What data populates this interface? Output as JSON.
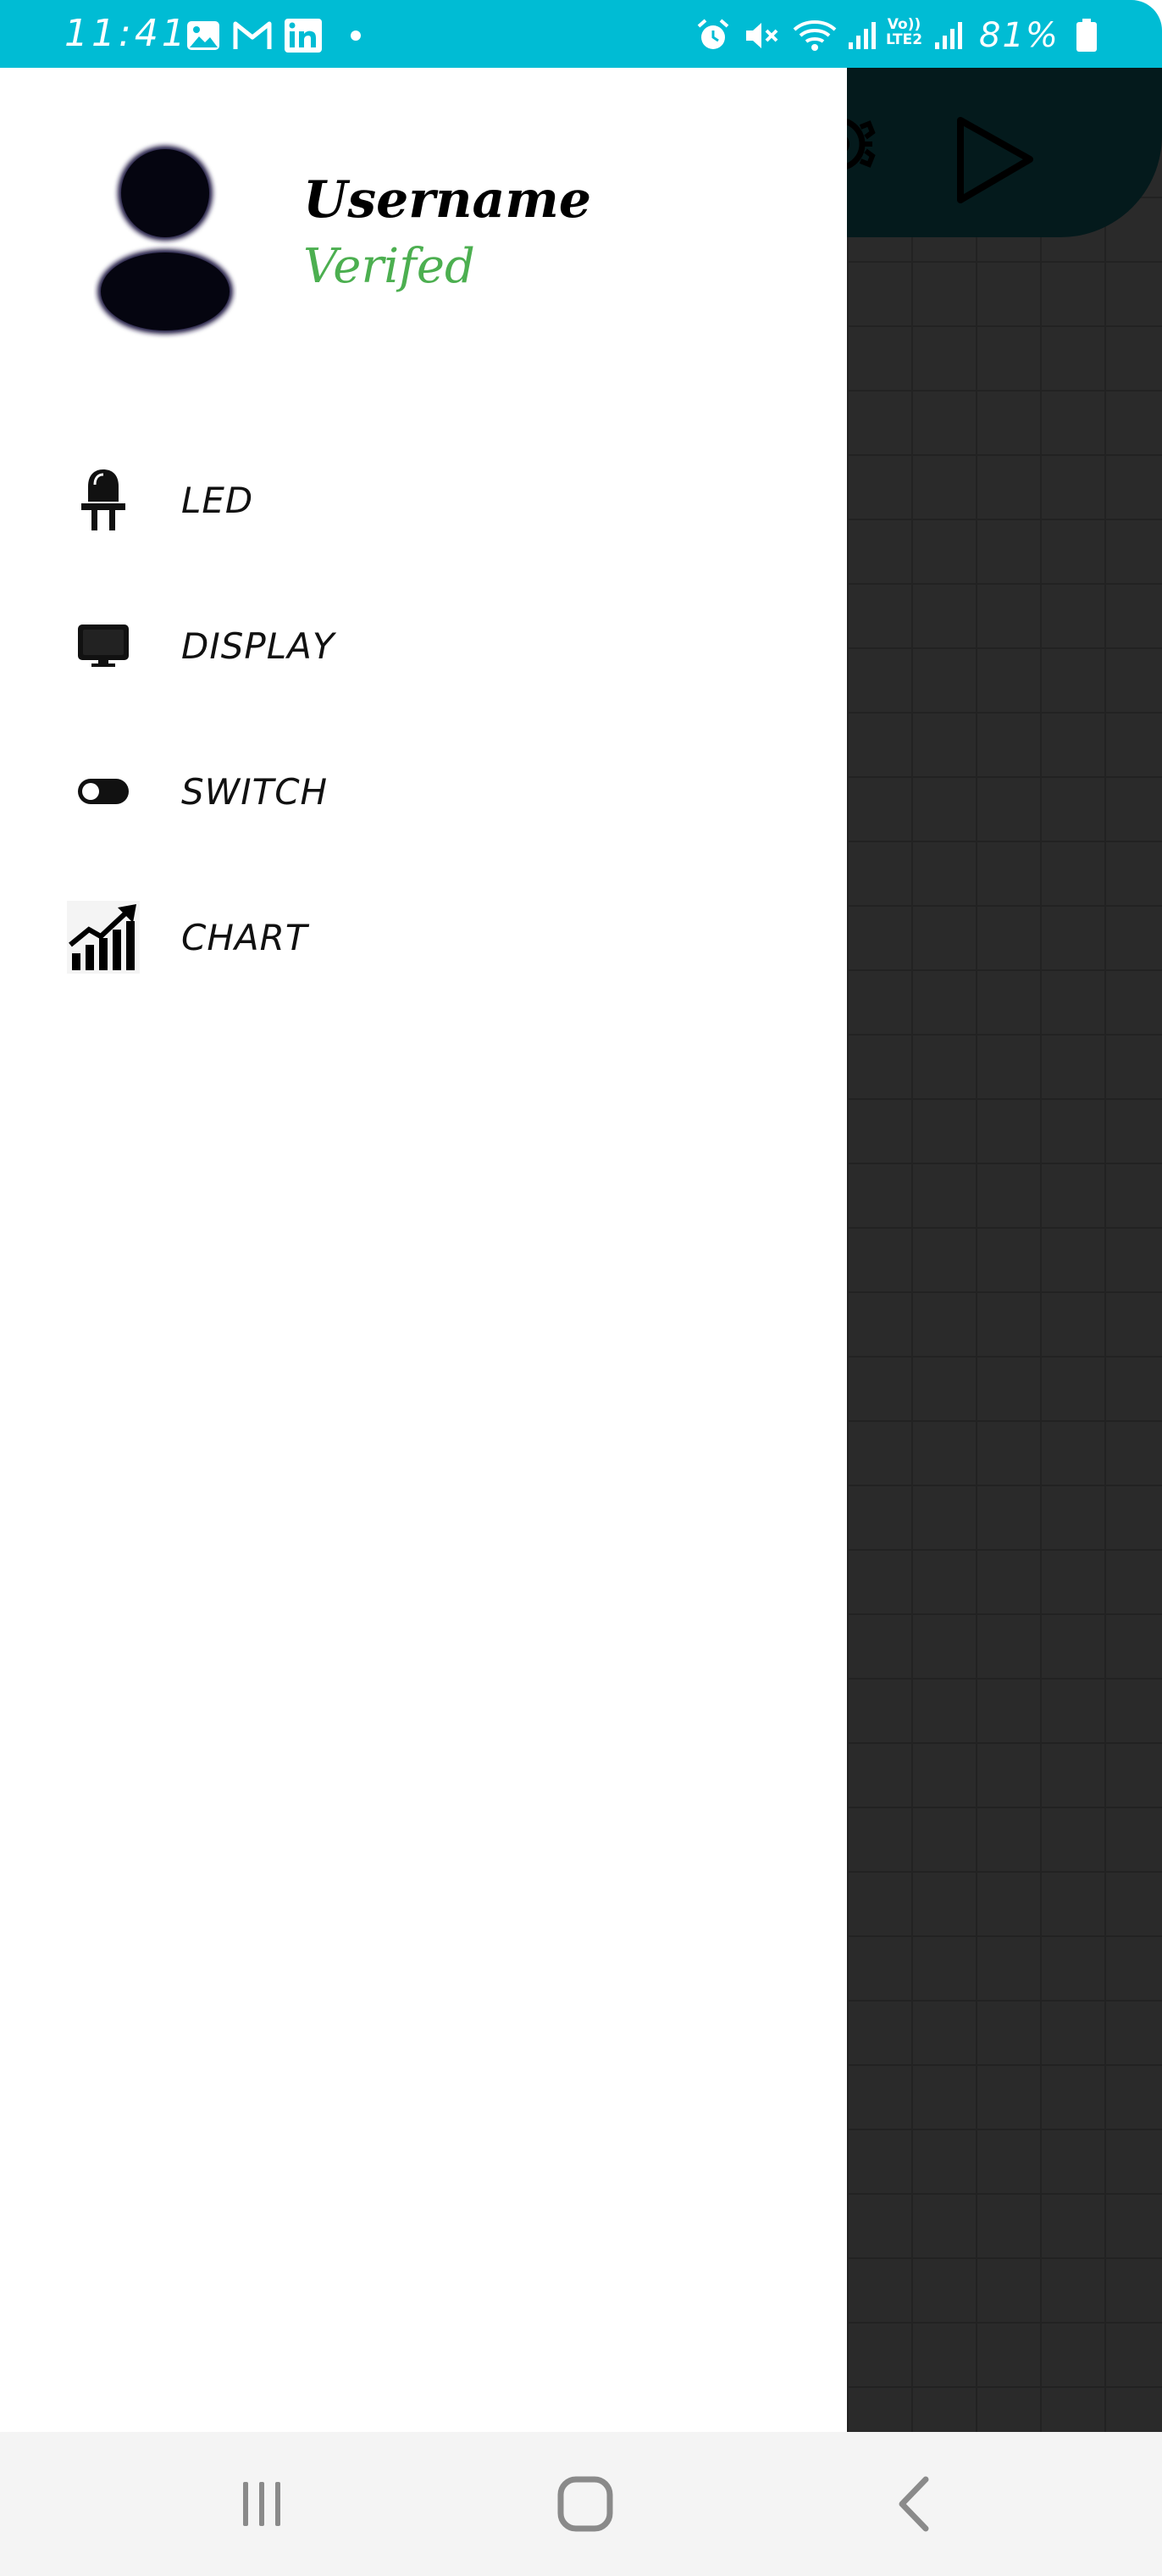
{
  "status_bar": {
    "time": "11:41",
    "battery_percent": "81%",
    "network_label_top": "Vo))",
    "network_label_bottom": "LTE2",
    "icons": [
      "gallery-icon",
      "gmail-icon",
      "linkedin-icon",
      "dot-icon",
      "alarm-icon",
      "mute-icon",
      "wifi-icon",
      "signal-icon",
      "signal-icon",
      "battery-icon"
    ]
  },
  "drawer": {
    "profile": {
      "username": "Username",
      "status": "Verifed",
      "status_color": "#4caf50"
    },
    "menu": [
      {
        "label": "LED",
        "icon": "led-icon"
      },
      {
        "label": "DISPLAY",
        "icon": "monitor-icon"
      },
      {
        "label": "SWITCH",
        "icon": "toggle-switch-icon"
      },
      {
        "label": "CHART",
        "icon": "chart-icon"
      }
    ]
  },
  "background_app": {
    "header_icons": [
      "settings-icon",
      "play-icon"
    ]
  },
  "navigation_bar": {
    "buttons": [
      "recent-apps-icon",
      "home-icon",
      "back-icon"
    ]
  },
  "colors": {
    "status_bar": "#00bcd4",
    "drawer_bg": "#ffffff",
    "app_bg": "#2a2a2a",
    "app_header": "#041a1c"
  }
}
